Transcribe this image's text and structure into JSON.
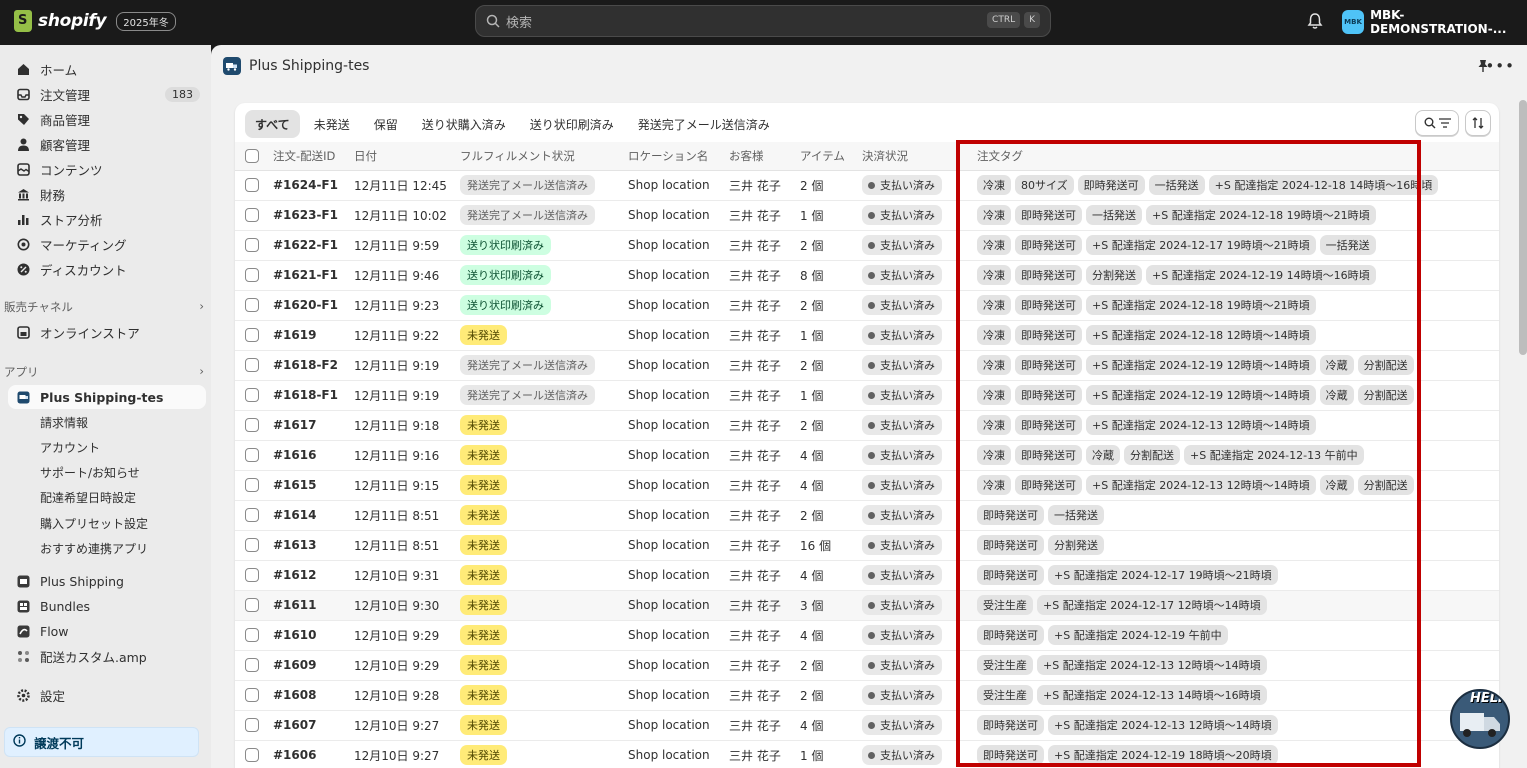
{
  "topbar": {
    "brand": "shopify",
    "edition_badge": "2025年冬",
    "search_placeholder": "検索",
    "shortcut_1": "CTRL",
    "shortcut_2": "K",
    "store_initials": "MBK",
    "store_name": "MBK-DEMONSTRATION-..."
  },
  "sidebar": {
    "items": [
      {
        "label": "ホーム",
        "icon": "home-icon"
      },
      {
        "label": "注文管理",
        "icon": "inbox-icon",
        "count": "183"
      },
      {
        "label": "商品管理",
        "icon": "tag-icon"
      },
      {
        "label": "顧客管理",
        "icon": "person-icon"
      },
      {
        "label": "コンテンツ",
        "icon": "content-icon"
      },
      {
        "label": "財務",
        "icon": "bank-icon"
      },
      {
        "label": "ストア分析",
        "icon": "chart-icon"
      },
      {
        "label": "マーケティング",
        "icon": "target-icon"
      },
      {
        "label": "ディスカウント",
        "icon": "discount-icon"
      }
    ],
    "sales_channels_label": "販売チャネル",
    "online_store": "オンラインストア",
    "apps_label": "アプリ",
    "active_app": "Plus Shipping-tes",
    "app_subitems": [
      "請求情報",
      "アカウント",
      "サポート/お知らせ",
      "配達希望日時設定",
      "購入プリセット設定",
      "おすすめ連携アプリ"
    ],
    "other_apps": [
      "Plus Shipping",
      "Bundles",
      "Flow",
      "配送カスタム.amp"
    ],
    "settings": "設定",
    "warning": "譲渡不可"
  },
  "page": {
    "title": "Plus Shipping-tes",
    "tabs": [
      "すべて",
      "未発送",
      "保留",
      "送り状購入済み",
      "送り状印刷済み",
      "発送完了メール送信済み"
    ],
    "columns": [
      "注文-配送ID",
      "日付",
      "フルフィルメント状況",
      "ロケーション名",
      "お客様",
      "アイテム",
      "決済状況",
      "注文タグ"
    ],
    "rows": [
      {
        "id": "#1624-F1",
        "date": "12月11日 12:45",
        "status": "発送完了メール送信済み",
        "status_type": "gray",
        "location": "Shop location",
        "customer": "三井 花子",
        "items": "2 個",
        "payment": "支払い済み",
        "tags": [
          "冷凍",
          "80サイズ",
          "即時発送可",
          "一括発送",
          "+S 配達指定 2024-12-18 14時頃〜16時頃"
        ]
      },
      {
        "id": "#1623-F1",
        "date": "12月11日 10:02",
        "status": "発送完了メール送信済み",
        "status_type": "gray",
        "location": "Shop location",
        "customer": "三井 花子",
        "items": "1 個",
        "payment": "支払い済み",
        "tags": [
          "冷凍",
          "即時発送可",
          "一括発送",
          "+S 配達指定 2024-12-18 19時頃〜21時頃"
        ]
      },
      {
        "id": "#1622-F1",
        "date": "12月11日 9:59",
        "status": "送り状印刷済み",
        "status_type": "green",
        "location": "Shop location",
        "customer": "三井 花子",
        "items": "2 個",
        "payment": "支払い済み",
        "tags": [
          "冷凍",
          "即時発送可",
          "+S 配達指定 2024-12-17 19時頃〜21時頃",
          "一括発送"
        ]
      },
      {
        "id": "#1621-F1",
        "date": "12月11日 9:46",
        "status": "送り状印刷済み",
        "status_type": "green",
        "location": "Shop location",
        "customer": "三井 花子",
        "items": "8 個",
        "payment": "支払い済み",
        "tags": [
          "冷凍",
          "即時発送可",
          "分割発送",
          "+S 配達指定 2024-12-19 14時頃〜16時頃"
        ]
      },
      {
        "id": "#1620-F1",
        "date": "12月11日 9:23",
        "status": "送り状印刷済み",
        "status_type": "green",
        "location": "Shop location",
        "customer": "三井 花子",
        "items": "2 個",
        "payment": "支払い済み",
        "tags": [
          "冷凍",
          "即時発送可",
          "+S 配達指定 2024-12-18 19時頃〜21時頃"
        ]
      },
      {
        "id": "#1619",
        "date": "12月11日 9:22",
        "status": "未発送",
        "status_type": "yellow",
        "location": "Shop location",
        "customer": "三井 花子",
        "items": "1 個",
        "payment": "支払い済み",
        "tags": [
          "冷凍",
          "即時発送可",
          "+S 配達指定 2024-12-18 12時頃〜14時頃"
        ]
      },
      {
        "id": "#1618-F2",
        "date": "12月11日 9:19",
        "status": "発送完了メール送信済み",
        "status_type": "gray",
        "location": "Shop location",
        "customer": "三井 花子",
        "items": "2 個",
        "payment": "支払い済み",
        "tags": [
          "冷凍",
          "即時発送可",
          "+S 配達指定 2024-12-19 12時頃〜14時頃",
          "冷蔵",
          "分割配送"
        ]
      },
      {
        "id": "#1618-F1",
        "date": "12月11日 9:19",
        "status": "発送完了メール送信済み",
        "status_type": "gray",
        "location": "Shop location",
        "customer": "三井 花子",
        "items": "1 個",
        "payment": "支払い済み",
        "tags": [
          "冷凍",
          "即時発送可",
          "+S 配達指定 2024-12-19 12時頃〜14時頃",
          "冷蔵",
          "分割配送"
        ]
      },
      {
        "id": "#1617",
        "date": "12月11日 9:18",
        "status": "未発送",
        "status_type": "yellow",
        "location": "Shop location",
        "customer": "三井 花子",
        "items": "2 個",
        "payment": "支払い済み",
        "tags": [
          "冷凍",
          "即時発送可",
          "+S 配達指定 2024-12-13 12時頃〜14時頃"
        ]
      },
      {
        "id": "#1616",
        "date": "12月11日 9:16",
        "status": "未発送",
        "status_type": "yellow",
        "location": "Shop location",
        "customer": "三井 花子",
        "items": "4 個",
        "payment": "支払い済み",
        "tags": [
          "冷凍",
          "即時発送可",
          "冷蔵",
          "分割配送",
          "+S 配達指定 2024-12-13 午前中"
        ]
      },
      {
        "id": "#1615",
        "date": "12月11日 9:15",
        "status": "未発送",
        "status_type": "yellow",
        "location": "Shop location",
        "customer": "三井 花子",
        "items": "4 個",
        "payment": "支払い済み",
        "tags": [
          "冷凍",
          "即時発送可",
          "+S 配達指定 2024-12-13 12時頃〜14時頃",
          "冷蔵",
          "分割配送"
        ]
      },
      {
        "id": "#1614",
        "date": "12月11日 8:51",
        "status": "未発送",
        "status_type": "yellow",
        "location": "Shop location",
        "customer": "三井 花子",
        "items": "2 個",
        "payment": "支払い済み",
        "tags": [
          "即時発送可",
          "一括発送"
        ]
      },
      {
        "id": "#1613",
        "date": "12月11日 8:51",
        "status": "未発送",
        "status_type": "yellow",
        "location": "Shop location",
        "customer": "三井 花子",
        "items": "16 個",
        "payment": "支払い済み",
        "tags": [
          "即時発送可",
          "分割発送"
        ]
      },
      {
        "id": "#1612",
        "date": "12月10日 9:31",
        "status": "未発送",
        "status_type": "yellow",
        "location": "Shop location",
        "customer": "三井 花子",
        "items": "4 個",
        "payment": "支払い済み",
        "tags": [
          "即時発送可",
          "+S 配達指定 2024-12-17 19時頃〜21時頃"
        ]
      },
      {
        "id": "#1611",
        "date": "12月10日 9:30",
        "status": "未発送",
        "status_type": "yellow",
        "location": "Shop location",
        "customer": "三井 花子",
        "items": "3 個",
        "payment": "支払い済み",
        "tags": [
          "受注生産",
          "+S 配達指定 2024-12-17 12時頃〜14時頃"
        ]
      },
      {
        "id": "#1610",
        "date": "12月10日 9:29",
        "status": "未発送",
        "status_type": "yellow",
        "location": "Shop location",
        "customer": "三井 花子",
        "items": "4 個",
        "payment": "支払い済み",
        "tags": [
          "即時発送可",
          "+S 配達指定 2024-12-19 午前中"
        ]
      },
      {
        "id": "#1609",
        "date": "12月10日 9:29",
        "status": "未発送",
        "status_type": "yellow",
        "location": "Shop location",
        "customer": "三井 花子",
        "items": "2 個",
        "payment": "支払い済み",
        "tags": [
          "受注生産",
          "+S 配達指定 2024-12-13 12時頃〜14時頃"
        ]
      },
      {
        "id": "#1608",
        "date": "12月10日 9:28",
        "status": "未発送",
        "status_type": "yellow",
        "location": "Shop location",
        "customer": "三井 花子",
        "items": "2 個",
        "payment": "支払い済み",
        "tags": [
          "受注生産",
          "+S 配達指定 2024-12-13 14時頃〜16時頃"
        ]
      },
      {
        "id": "#1607",
        "date": "12月10日 9:27",
        "status": "未発送",
        "status_type": "yellow",
        "location": "Shop location",
        "customer": "三井 花子",
        "items": "4 個",
        "payment": "支払い済み",
        "tags": [
          "即時発送可",
          "+S 配達指定 2024-12-13 12時頃〜14時頃"
        ]
      },
      {
        "id": "#1606",
        "date": "12月10日 9:27",
        "status": "未発送",
        "status_type": "yellow",
        "location": "Shop location",
        "customer": "三井 花子",
        "items": "1 個",
        "payment": "支払い済み",
        "tags": [
          "即時発送可",
          "+S 配達指定 2024-12-19 18時頃〜20時頃"
        ]
      }
    ]
  },
  "help_label": "HELP",
  "colors": {
    "highlight_border": "#c00000",
    "topbar_bg": "#1a1a1a",
    "unfulfilled_badge": "#ffeb78",
    "printed_badge": "#cdfee1"
  }
}
